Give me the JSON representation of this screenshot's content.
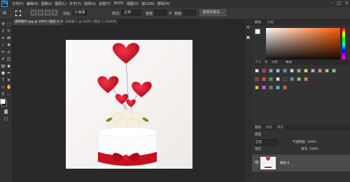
{
  "menubar": {
    "app_icon": "photoshop-logo-icon",
    "app_logo_text": "Ps",
    "items": [
      "文件(F)",
      "编辑(E)",
      "图像(I)",
      "图层(L)",
      "文字(Y)",
      "选择(S)",
      "滤镜(T)",
      "3D(D)",
      "视图(V)",
      "窗口(W)",
      "帮助(H)"
    ],
    "window_controls": [
      "–",
      "□",
      "×"
    ]
  },
  "options_bar": {
    "feather_label": "羽化:",
    "feather_value": "0 像素",
    "style_label": "样式:",
    "style_value": "正常",
    "width_label": "宽度:",
    "height_label": "高度:",
    "select_mask_button": "选择并遮住..."
  },
  "tabs": [
    {
      "label": "蛋糕图片.jpg @ 100% (图层 0, RGB/8#)",
      "active": true
    },
    {
      "label": "未标题-1 @ 100% (图层 1, RGB/8)",
      "active": false
    }
  ],
  "tools": [
    "move-icon",
    "marquee-icon",
    "lasso-icon",
    "quick-select-icon",
    "crop-icon",
    "frame-icon",
    "eyedropper-icon",
    "healing-icon",
    "brush-icon",
    "stamp-icon",
    "history-brush-icon",
    "eraser-icon",
    "gradient-icon",
    "blur-icon",
    "dodge-icon",
    "pen-icon",
    "type-icon",
    "path-select-icon",
    "rectangle-icon",
    "hand-icon",
    "zoom-icon",
    "more-icon"
  ],
  "color_panel": {
    "title": "颜色",
    "tab2": "色板",
    "foreground": "#ffffff",
    "background": "#000000",
    "hue_color": "#ff5a00"
  },
  "adjust_panel": {
    "tabs": [
      "学习",
      "库",
      "调整",
      "样式"
    ]
  },
  "layers_panel": {
    "tabs": [
      "图层",
      "通道",
      "路径"
    ],
    "kind_label": "类型",
    "blend_mode": "正常",
    "opacity_label": "不透明度:",
    "opacity_value": "100%",
    "lock_label": "锁定:",
    "fill_label": "填充:",
    "fill_value": "100%",
    "layer_name": "图层 0"
  }
}
